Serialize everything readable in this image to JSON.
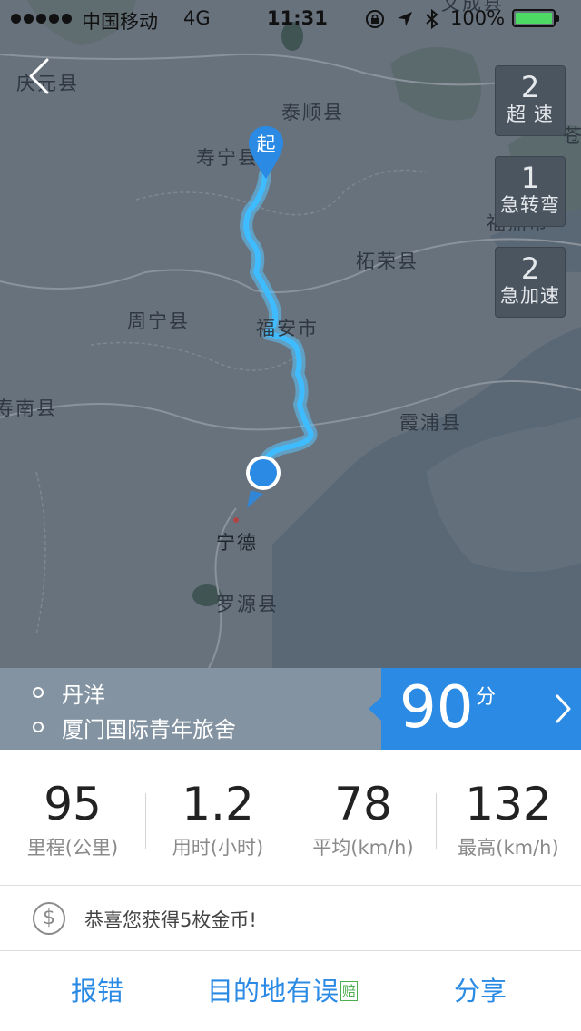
{
  "status_bar": {
    "carrier": "中国移动",
    "network": "4G",
    "time": "11:31",
    "battery": "100%"
  },
  "map": {
    "places": [
      "庆元县",
      "泰顺县",
      "寿宁县",
      "柘荣县",
      "周宁县",
      "福安市",
      "寿南县",
      "霞浦县",
      "宁德",
      "罗源县",
      "福鼎市",
      "苍",
      "文成县"
    ],
    "start_marker": "起",
    "route_color": "#3fbcff"
  },
  "badges": [
    {
      "count": "2",
      "label": "超 速"
    },
    {
      "count": "1",
      "label": "急转弯"
    },
    {
      "count": "2",
      "label": "急加速"
    }
  ],
  "route": {
    "start": "丹洋",
    "end": "厦门国际青年旅舍"
  },
  "score": {
    "value": "90",
    "unit": "分"
  },
  "stats": [
    {
      "value": "95",
      "caption": "里程(公里)"
    },
    {
      "value": "1.2",
      "caption": "用时(小时)"
    },
    {
      "value": "78",
      "caption": "平均(km/h)"
    },
    {
      "value": "132",
      "caption": "最高(km/h)"
    }
  ],
  "coin": {
    "icon": "dollar-coin-icon",
    "text": "恭喜您获得5枚金币!"
  },
  "actions": {
    "report": "报错",
    "destination_error": "目的地有误",
    "compensation_tag": "赔",
    "share": "分享"
  },
  "colors": {
    "accent": "#2a8ae4",
    "map_land": "#68727d",
    "map_water": "#5c6a78",
    "score_bar": "#8393a1"
  }
}
